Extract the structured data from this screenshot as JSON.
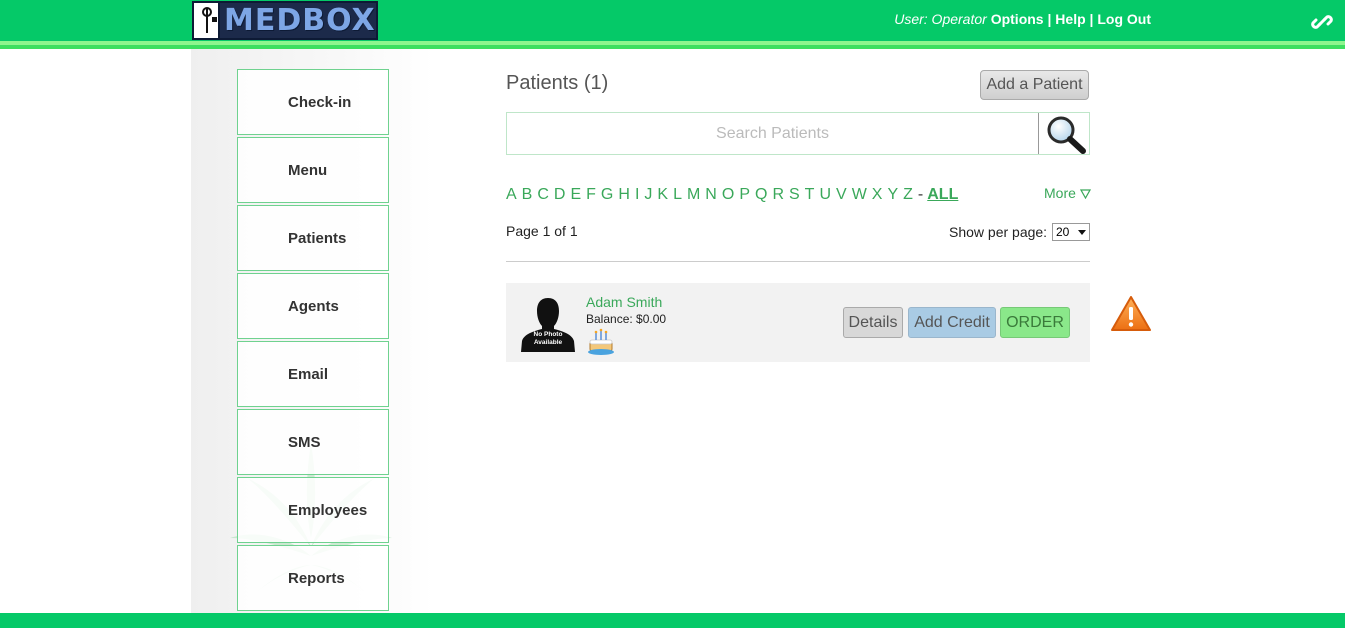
{
  "header": {
    "logo_text": "MEDBOX",
    "user_label": "User: Operator",
    "options_label": "Options",
    "sep1": "|",
    "help_label": "Help",
    "sep2": "|",
    "logout_label": "Log Out"
  },
  "sidebar": {
    "items": [
      {
        "label": "Check-in"
      },
      {
        "label": "Menu"
      },
      {
        "label": "Patients"
      },
      {
        "label": "Agents"
      },
      {
        "label": "Email"
      },
      {
        "label": "SMS"
      },
      {
        "label": "Employees"
      },
      {
        "label": "Reports"
      }
    ]
  },
  "main": {
    "title": "Patients (1)",
    "add_patient_label": "Add a Patient",
    "search_placeholder": "Search Patients",
    "letters": [
      "A",
      "B",
      "C",
      "D",
      "E",
      "F",
      "G",
      "H",
      "I",
      "J",
      "K",
      "L",
      "M",
      "N",
      "O",
      "P",
      "Q",
      "R",
      "S",
      "T",
      "U",
      "V",
      "W",
      "X",
      "Y",
      "Z"
    ],
    "dash": "-",
    "all_label": "ALL",
    "more_label": "More",
    "page_info": "Page 1 of 1",
    "show_per_page_label": "Show per page:",
    "per_page_value": "20",
    "patients": [
      {
        "name": "Adam Smith",
        "balance": "Balance: $0.00",
        "photo_text": "No Photo Available",
        "details_label": "Details",
        "add_credit_label": "Add Credit",
        "order_label": "ORDER"
      }
    ]
  },
  "colors": {
    "header_green": "#05c968",
    "link_green": "#3aa85a",
    "order_green": "#8ae88a",
    "credit_blue": "#a9cbe4",
    "warning_orange": "#f08a24"
  }
}
